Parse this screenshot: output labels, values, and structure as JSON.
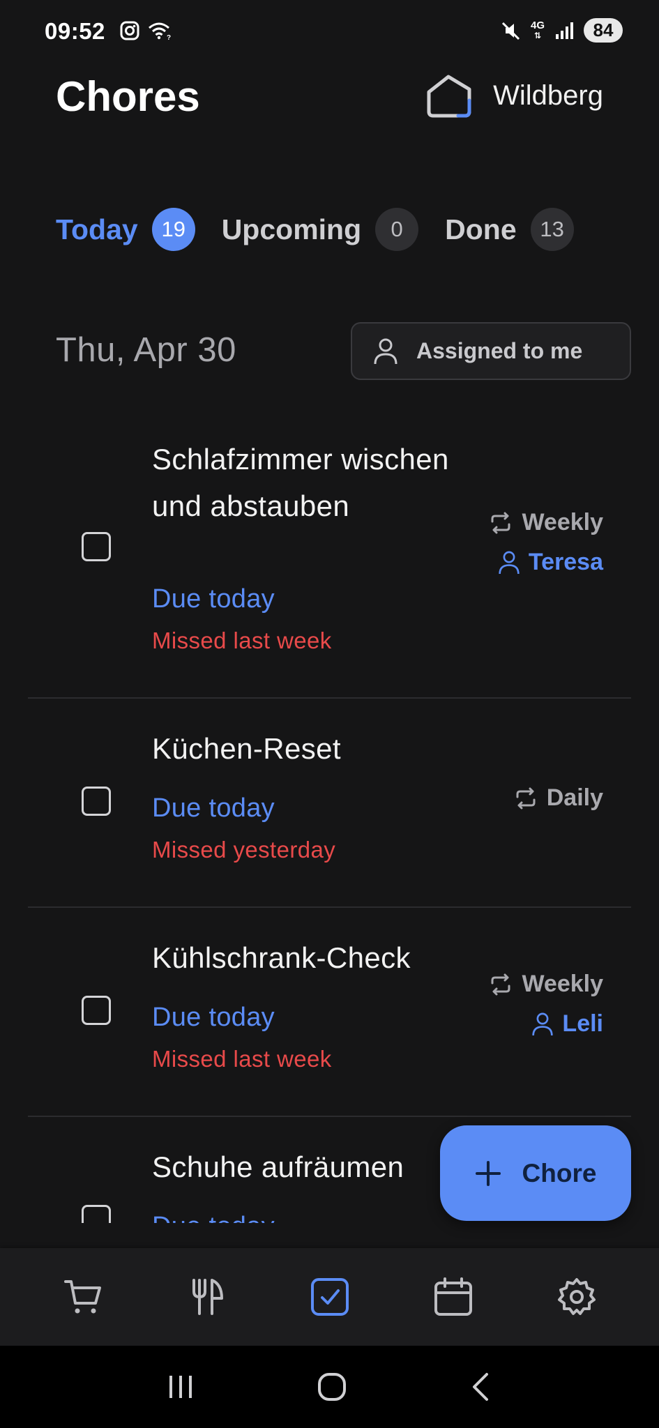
{
  "status_bar": {
    "time": "09:52",
    "network": "4G",
    "battery": "84"
  },
  "header": {
    "title": "Chores",
    "household_name": "Wildberg"
  },
  "tabs": [
    {
      "label": "Today",
      "count": "19",
      "active": true
    },
    {
      "label": "Upcoming",
      "count": "0",
      "active": false
    },
    {
      "label": "Done",
      "count": "13",
      "active": false
    }
  ],
  "date_label": "Thu, Apr 30",
  "filter": {
    "label": "Assigned to me"
  },
  "chores": [
    {
      "title": "Schlafzimmer wischen und abstauben",
      "due": "Due today",
      "missed": "Missed last week",
      "frequency": "Weekly",
      "assignee": "Teresa"
    },
    {
      "title": "Küchen-Reset",
      "due": "Due today",
      "missed": "Missed yesterday",
      "frequency": "Daily",
      "assignee": ""
    },
    {
      "title": "Kühlschrank-Check",
      "due": "Due today",
      "missed": "Missed last week",
      "frequency": "Weekly",
      "assignee": "Leli"
    },
    {
      "title": "Schuhe aufräumen",
      "due": "Due today",
      "missed": "",
      "frequency": "",
      "assignee": ""
    }
  ],
  "fab": {
    "label": "Chore"
  },
  "bottom_nav": [
    {
      "icon": "cart-icon",
      "active": false
    },
    {
      "icon": "utensils-icon",
      "active": false
    },
    {
      "icon": "checkbox-icon",
      "active": true
    },
    {
      "icon": "calendar-icon",
      "active": false
    },
    {
      "icon": "settings-icon",
      "active": false
    }
  ],
  "colors": {
    "background": "#151516",
    "accent": "#5b8cf5",
    "missed": "#e84a4a"
  }
}
